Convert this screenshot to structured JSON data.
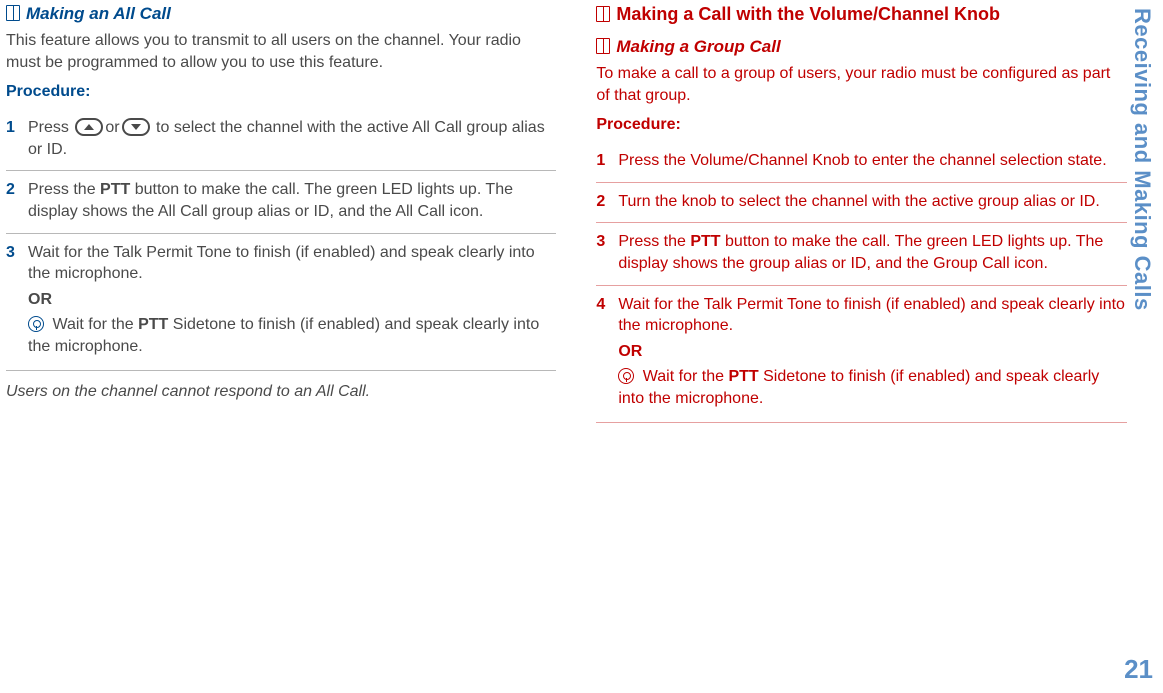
{
  "sideTitle": "Receiving and Making Calls",
  "pageNumber": "21",
  "left": {
    "heading": "Making an All Call",
    "intro": "This feature allows you to transmit to all users on the channel. Your radio must be programmed to allow you to use this feature.",
    "procLabel": "Procedure:",
    "steps": {
      "s1_a": "Press ",
      "s1_mid": "or",
      "s1_b": " to select the channel with the active All Call group alias or ID.",
      "s2_a": "Press the ",
      "s2_ptt": "PTT",
      "s2_b": " button to make the call. The green LED lights up. The display shows the All Call group alias or ID, and the All Call icon.",
      "s3_a": "Wait for the Talk Permit Tone to finish (if enabled) and speak clearly into the microphone.",
      "s3_or": "OR",
      "s3_b1": " Wait for the ",
      "s3_ptt": "PTT",
      "s3_b2": " Sidetone to finish (if enabled) and speak clearly into the microphone."
    },
    "note": "Users on the channel cannot respond to an All Call."
  },
  "right": {
    "mainHeading": "Making a Call with the Volume/Channel Knob",
    "subHeading": "Making a Group Call",
    "intro": "To make a call to a group of users, your radio must be configured as part of that group.",
    "procLabel": "Procedure:",
    "steps": {
      "s1": "Press the Volume/Channel Knob to enter the channel selection state.",
      "s2": "Turn the knob to select the channel with the active group alias or ID.",
      "s3_a": "Press the ",
      "s3_ptt": "PTT",
      "s3_b": " button to make the call. The green LED lights up. The display shows the group alias or ID, and the Group Call icon.",
      "s4_a": "Wait for the Talk Permit Tone to finish (if enabled) and speak clearly into the microphone.",
      "s4_or": "OR",
      "s4_b1": " Wait for the ",
      "s4_ptt": "PTT",
      "s4_b2": " Sidetone to finish (if enabled) and speak clearly into the microphone."
    }
  }
}
